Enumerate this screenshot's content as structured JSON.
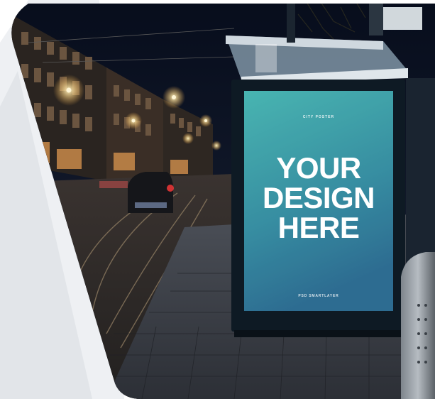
{
  "scene": {
    "description_free": true
  },
  "poster": {
    "kicker": "CITY POSTER",
    "headline_line1": "YOUR",
    "headline_line2": "DESIGN",
    "headline_line3": "HERE",
    "footer": "PSD SMARTLAYER"
  },
  "colors": {
    "backdrop_light": "#eef0f3",
    "backdrop_mid": "#dcdfe3",
    "sky": "#0b1426",
    "poster_top": "#3fb1ad",
    "poster_bottom": "#22658c",
    "shelter_frame": "#0e1a24",
    "street_light": "#ffd98a"
  }
}
